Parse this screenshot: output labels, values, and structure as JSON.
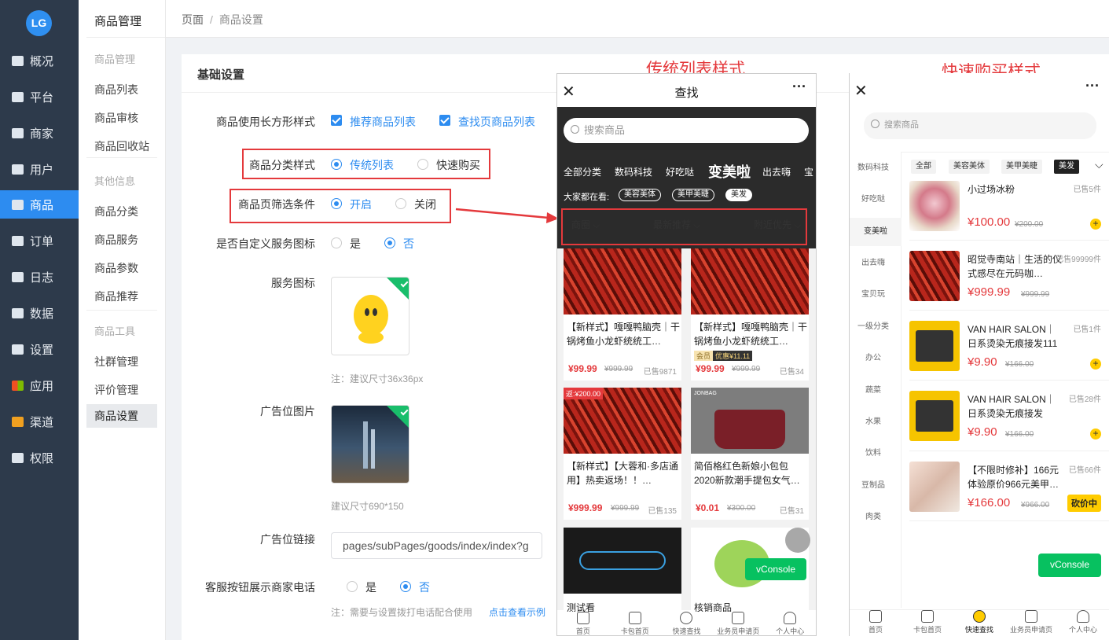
{
  "logo": "LG",
  "nav": {
    "items": [
      {
        "label": "概况",
        "icon": "overview-icon"
      },
      {
        "label": "平台",
        "icon": "platform-icon"
      },
      {
        "label": "商家",
        "icon": "merchant-icon"
      },
      {
        "label": "用户",
        "icon": "user-icon"
      },
      {
        "label": "商品",
        "icon": "goods-icon"
      },
      {
        "label": "订单",
        "icon": "order-icon"
      },
      {
        "label": "日志",
        "icon": "log-icon"
      },
      {
        "label": "数据",
        "icon": "data-icon"
      },
      {
        "label": "设置",
        "icon": "settings-icon"
      },
      {
        "label": "应用",
        "icon": "apps-icon"
      },
      {
        "label": "渠道",
        "icon": "channel-icon"
      },
      {
        "label": "权限",
        "icon": "lock-icon"
      }
    ],
    "active": "商品"
  },
  "subnav": {
    "title": "商品管理",
    "groups": [
      "商品管理",
      "其他信息",
      "商品工具"
    ],
    "items": [
      "商品列表",
      "商品审核",
      "商品回收站",
      "商品分类",
      "商品服务",
      "商品参数",
      "商品推荐",
      "社群管理",
      "评价管理",
      "商品设置"
    ]
  },
  "breadcrumb": {
    "root": "页面",
    "sep": "/",
    "current": "商品设置"
  },
  "settings": {
    "title": "基础设置",
    "rect_style": {
      "label": "商品使用长方形样式",
      "opt1": "推荐商品列表",
      "opt2": "查找页商品列表"
    },
    "cat_style": {
      "label": "商品分类样式",
      "opt1": "传统列表",
      "opt2": "快速购买"
    },
    "filter": {
      "label": "商品页筛选条件",
      "opt1": "开启",
      "opt2": "关闭"
    },
    "custom_icon": {
      "label": "是否自定义服务图标",
      "opt1": "是",
      "opt2": "否"
    },
    "service_icon": {
      "label": "服务图标",
      "hint": "注：建议尺寸36x36px"
    },
    "ad_image": {
      "label": "广告位图片",
      "hint": "建议尺寸690*150"
    },
    "ad_link": {
      "label": "广告位链接",
      "value": "pages/subPages/goods/index/index?g"
    },
    "phone_btn": {
      "label": "客服按钮展示商家电话",
      "opt1": "是",
      "opt2": "否",
      "hint": "注：需要与设置拨打电话配合使用",
      "link": "点击查看示例"
    }
  },
  "annotations": {
    "left_title": "传统列表样式",
    "right_title": "快速购买样式"
  },
  "phone1": {
    "title": "查找",
    "close": "✕",
    "more": "···",
    "search_placeholder": "搜索商品",
    "cats": [
      "全部分类",
      "数码科技",
      "好吃哒",
      "变美啦",
      "出去嗨",
      "宝"
    ],
    "hot_label": "大家都在看:",
    "hot": [
      "美容美体",
      "美甲美睫",
      "美发"
    ],
    "filters": [
      "商圈",
      "最新推荐",
      "附近优先"
    ],
    "goods": [
      {
        "name": "【新样式】嘎嘎鸭脑壳｜干锅烤鱼小龙虾统统工…",
        "price": "¥99.99",
        "old": "¥999.99",
        "sold": "已售9871"
      },
      {
        "name": "【新样式】嘎嘎鸭脑壳｜干锅烤鱼小龙虾统统工…",
        "price": "¥99.99",
        "old": "¥999.99",
        "sold": "已售34",
        "badge1": "会员",
        "badge2": "优惠¥11.11"
      },
      {
        "name": "【新样式】【大蓉和·多店通用】热卖返场！！…",
        "price": "¥999.99",
        "old": "¥999.99",
        "sold": "已售135",
        "tag": "返:¥200.00"
      },
      {
        "name": "简佰格红色新娘小包包2020新款潮手提包女气…",
        "price": "¥0.01",
        "old": "¥300.00",
        "sold": "已售31",
        "brand": "JONBAG"
      },
      {
        "name": "测试看",
        "price": "",
        "old": "",
        "sold": ""
      },
      {
        "name": "核销商品",
        "price": "",
        "old": "",
        "sold": ""
      }
    ],
    "vconsole": "vConsole",
    "tabs": [
      "首页",
      "卡包首页",
      "快速查找",
      "业务员申请页",
      "个人中心"
    ]
  },
  "phone2": {
    "close": "✕",
    "more": "···",
    "search_placeholder": "搜索商品",
    "side": [
      "数码科技",
      "好吃哒",
      "变美啦",
      "出去嗨",
      "宝贝玩",
      "一级分类",
      "办公",
      "蔬菜",
      "水果",
      "饮料",
      "豆制品",
      "肉类"
    ],
    "active_side": "变美啦",
    "chips": [
      "全部",
      "美容美体",
      "美甲美睫",
      "美发"
    ],
    "items": [
      {
        "name": "小过场冰粉",
        "price": "¥100.00",
        "old": "¥200.00",
        "sold": "已售5件"
      },
      {
        "name": "昭觉寺南站｜生活的仪式感尽在元码咖…",
        "price": "¥999.99",
        "old": "¥999.99",
        "sold": "已售99999件"
      },
      {
        "name": "VAN HAIR SALON｜日系烫染无痕接发111",
        "price": "¥9.90",
        "old": "¥166.00",
        "sold": "已售1件"
      },
      {
        "name": "VAN HAIR SALON｜日系烫染无痕接发",
        "price": "¥9.90",
        "old": "¥166.00",
        "sold": "已售28件"
      },
      {
        "name": "【不限时修补】166元体验原价966元美甲…",
        "price": "¥166.00",
        "old": "¥966.00",
        "sold": "已售66件",
        "btn": "砍价中"
      }
    ],
    "vconsole": "vConsole",
    "tabs": [
      "首页",
      "卡包首页",
      "快速查找",
      "业务员申请页",
      "个人中心"
    ]
  },
  "colors": {
    "accent": "#2d8cf0",
    "nav_bg": "#2d3a4b",
    "highlight": "#e4393c",
    "vconsole": "#07c160"
  }
}
